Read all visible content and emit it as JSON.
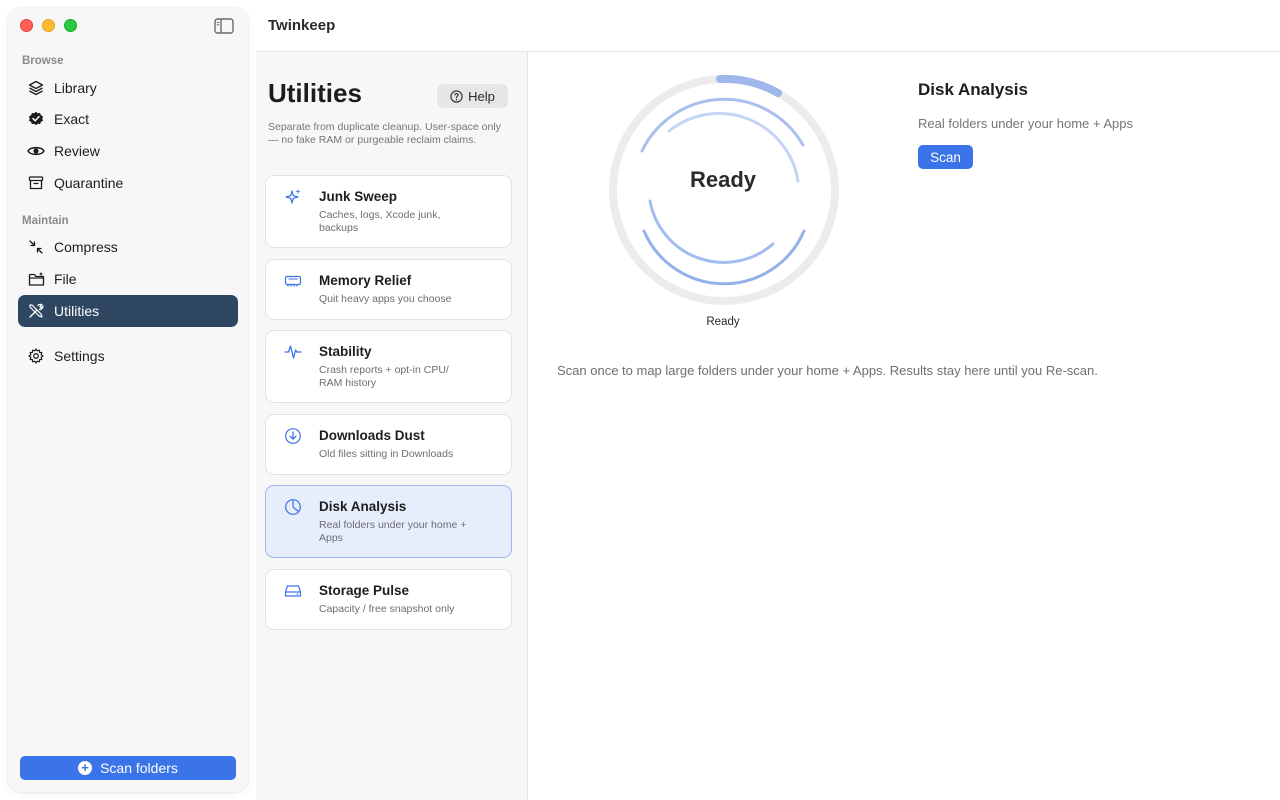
{
  "app": {
    "title": "Twinkeep"
  },
  "sidebar": {
    "sections": {
      "browse": "Browse",
      "maintain": "Maintain"
    },
    "items": [
      {
        "label": "Library",
        "icon": "layers-icon"
      },
      {
        "label": "Exact",
        "icon": "verified-badge-icon"
      },
      {
        "label": "Review",
        "icon": "eye-icon"
      },
      {
        "label": "Quarantine",
        "icon": "archive-box-icon"
      },
      {
        "label": "Compress",
        "icon": "compress-arrows-icon"
      },
      {
        "label": "File",
        "icon": "folder-icon"
      },
      {
        "label": "Utilities",
        "icon": "tools-icon",
        "active": true
      },
      {
        "label": "Settings",
        "icon": "gear-icon"
      }
    ],
    "scan_button": "Scan folders"
  },
  "utilities": {
    "title": "Utilities",
    "help": "Help",
    "description": "Separate from duplicate cleanup. User-space only — no fake RAM or purgeable reclaim claims.",
    "cards": [
      {
        "title": "Junk Sweep",
        "desc": "Caches, logs, Xcode junk, backups",
        "icon": "sparkles-icon"
      },
      {
        "title": "Memory Relief",
        "desc": "Quit heavy apps you choose",
        "icon": "memory-chip-icon"
      },
      {
        "title": "Stability",
        "desc": "Crash reports + opt-in CPU/ RAM history",
        "icon": "waveform-icon"
      },
      {
        "title": "Downloads Dust",
        "desc": "Old files sitting in Downloads",
        "icon": "download-circle-icon"
      },
      {
        "title": "Disk Analysis",
        "desc": "Real folders under your home + Apps",
        "icon": "pie-chart-icon",
        "active": true
      },
      {
        "title": "Storage Pulse",
        "desc": "Capacity / free snapshot only",
        "icon": "drive-icon"
      }
    ]
  },
  "detail": {
    "status": "Ready",
    "status_caption": "Ready",
    "title": "Disk Analysis",
    "subtitle": "Real folders under your home + Apps",
    "scan_label": "Scan",
    "info": "Scan once to map large folders under your home + Apps. Results stay here until you Re-scan."
  },
  "colors": {
    "accent": "#3b73e8",
    "sidebar_active": "#2e4660",
    "card_active": "#e6eefc"
  }
}
